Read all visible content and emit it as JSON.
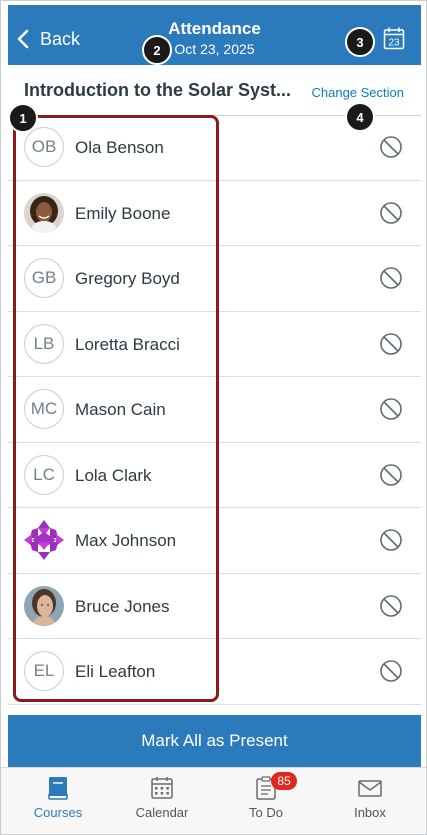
{
  "header": {
    "back_label": "Back",
    "title": "Attendance",
    "date": "Oct 23, 2025",
    "calendar_day": "23"
  },
  "section": {
    "course_name": "Introduction to the Solar Syst...",
    "change_section_label": "Change Section"
  },
  "students": [
    {
      "name": "Ola Benson",
      "initials": "OB",
      "avatar": "initials"
    },
    {
      "name": "Emily Boone",
      "initials": "",
      "avatar": "photo"
    },
    {
      "name": "Gregory Boyd",
      "initials": "GB",
      "avatar": "initials"
    },
    {
      "name": "Loretta Bracci",
      "initials": "LB",
      "avatar": "initials"
    },
    {
      "name": "Mason Cain",
      "initials": "MC",
      "avatar": "initials"
    },
    {
      "name": "Lola Clark",
      "initials": "LC",
      "avatar": "initials"
    },
    {
      "name": "Max Johnson",
      "initials": "",
      "avatar": "pattern"
    },
    {
      "name": "Bruce Jones",
      "initials": "",
      "avatar": "photo"
    },
    {
      "name": "Eli Leafton",
      "initials": "EL",
      "avatar": "initials"
    }
  ],
  "status_icon": "unmarked-icon",
  "mark_all_label": "Mark All as Present",
  "callouts": [
    "1",
    "2",
    "3",
    "4"
  ],
  "tabs": [
    {
      "label": "Courses",
      "icon": "courses-icon",
      "active": true
    },
    {
      "label": "Calendar",
      "icon": "calendar-icon",
      "active": false
    },
    {
      "label": "To Do",
      "icon": "todo-icon",
      "active": false,
      "badge": "85"
    },
    {
      "label": "Inbox",
      "icon": "inbox-icon",
      "active": false
    }
  ],
  "colors": {
    "brand_blue": "#2b7abc",
    "link_blue": "#0a7dc2",
    "callout_highlight": "#8b1a1a",
    "badge_red": "#e0281e"
  }
}
